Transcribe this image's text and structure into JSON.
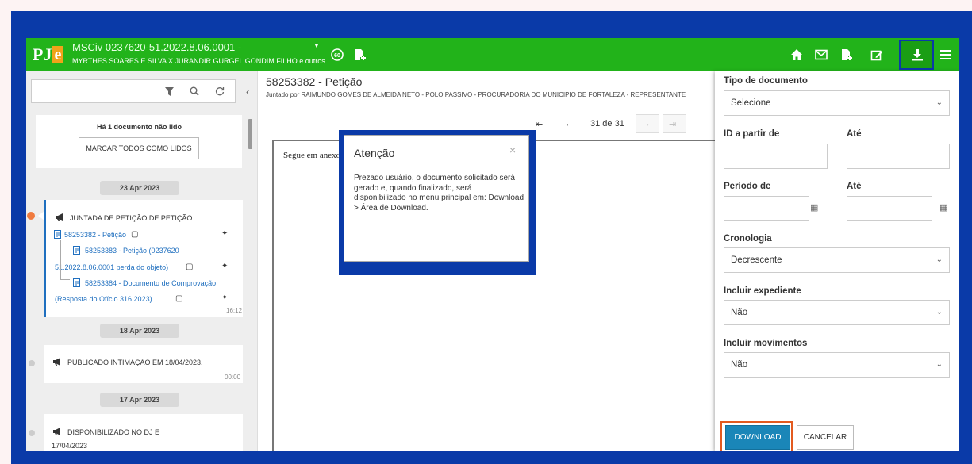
{
  "header": {
    "process_number": "MSCiv 0237620-51.2022.8.06.0001 - ",
    "parties": "MYRTHES SOARES E SILVA X JURANDIR GURGEL GONDIM FILHO e outros",
    "icons": [
      "home-icon",
      "mail-icon",
      "document-add-icon",
      "edit-icon",
      "download-icon",
      "menu-icon"
    ]
  },
  "left": {
    "unread": "Há 1 documento não lido",
    "mark_all": "MARCAR TODOS COMO LIDOS",
    "groups": [
      {
        "date": "23 Apr 2023",
        "event": "JUNTADA DE PETIÇÃO DE PETIÇÃO",
        "docs": [
          {
            "line1": "58253382 - Petição"
          },
          {
            "line1": "58253383 - Petição (0237620",
            "line2": "51.2022.8.06.0001 perda do objeto)"
          },
          {
            "line1": "58253384 - Documento de Comprovação",
            "line2": "(Resposta do Ofício 316 2023)"
          }
        ],
        "time": "16:12"
      },
      {
        "date": "18 Apr 2023",
        "event": "PUBLICADO INTIMAÇÃO EM 18/04/2023.",
        "time": "00:00"
      },
      {
        "date": "17 Apr 2023",
        "event": "DISPONIBILIZADO NO DJ E",
        "event_line2": "17/04/2023"
      }
    ]
  },
  "center": {
    "title": "58253382 - Petição",
    "subtitle": "Juntado por RAIMUNDO GOMES DE ALMEIDA NETO - POLO PASSIVO - PROCURADORIA DO MUNICIPIO DE FORTALEZA - REPRESENTANTE",
    "pager": "31 de 31",
    "viewer_text": "Segue em anexo."
  },
  "modal": {
    "title": "Atenção",
    "body": "Prezado usuário, o documento solicitado será gerado e, quando finalizado, será disponibilizado no menu principal em: Download > Área de Download."
  },
  "right": {
    "tipo_label": "Tipo de documento",
    "tipo_value": "Selecione",
    "id_from_label": "ID a partir de",
    "id_to_label": "Até",
    "periodo_label": "Período de",
    "periodo_to_label": "Até",
    "crono_label": "Cronologia",
    "crono_value": "Decrescente",
    "exped_label": "Incluir expediente",
    "exped_value": "Não",
    "mov_label": "Incluir movimentos",
    "mov_value": "Não",
    "download": "DOWNLOAD",
    "cancel": "CANCELAR"
  },
  "colors": {
    "header_green": "#22b31a",
    "frame_blue": "#0a3aa8",
    "download_blue": "#1a86b8",
    "highlight_orange": "#e35a1f"
  }
}
